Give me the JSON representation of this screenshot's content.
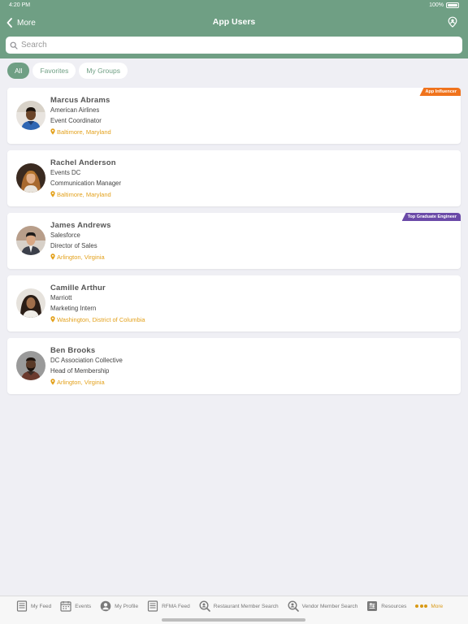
{
  "status_bar": {
    "time": "4:20 PM",
    "battery": "100%"
  },
  "header": {
    "back_label": "More",
    "title": "App Users"
  },
  "search": {
    "placeholder": "Search"
  },
  "filters": [
    {
      "label": "All",
      "active": true
    },
    {
      "label": "Favorites",
      "active": false
    },
    {
      "label": "My Groups",
      "active": false
    }
  ],
  "users": [
    {
      "name": "Marcus Abrams",
      "company": "American Airlines",
      "title": "Event Coordinator",
      "location": "Baltimore, Maryland",
      "badge": "App Influencer",
      "badge_color": "#f0731c"
    },
    {
      "name": "Rachel Anderson",
      "company": "Events DC",
      "title": "Communication Manager",
      "location": "Baltimore, Maryland",
      "badge": "",
      "badge_color": ""
    },
    {
      "name": "James Andrews",
      "company": "Salesforce",
      "title": "Director of Sales",
      "location": "Arlington, Virginia",
      "badge": "Top Graduate Engineer",
      "badge_color": "#6b4aa8"
    },
    {
      "name": "Camille Arthur",
      "company": "Marriott",
      "title": "Marketing Intern",
      "location": "Washington, District of Columbia",
      "badge": "",
      "badge_color": ""
    },
    {
      "name": "Ben Brooks",
      "company": "DC Association Collective",
      "title": "Head of Membership",
      "location": "Arlington, Virginia",
      "badge": "",
      "badge_color": ""
    }
  ],
  "tab_bar": {
    "tabs": [
      {
        "label": "My Feed",
        "icon": "feed-icon"
      },
      {
        "label": "Events",
        "icon": "calendar-icon"
      },
      {
        "label": "My Profile",
        "icon": "profile-icon"
      },
      {
        "label": "RFMA Feed",
        "icon": "feed-icon"
      },
      {
        "label": "Restaurant Member Search",
        "icon": "member-search-icon"
      },
      {
        "label": "Vendor Member Search",
        "icon": "member-search-icon"
      },
      {
        "label": "Resources",
        "icon": "resources-icon"
      },
      {
        "label": "More",
        "icon": "more-dots-icon",
        "active": true
      }
    ]
  },
  "colors": {
    "header": "#6f9f84",
    "accent": "#d99a16",
    "location": "#e3a11c"
  }
}
